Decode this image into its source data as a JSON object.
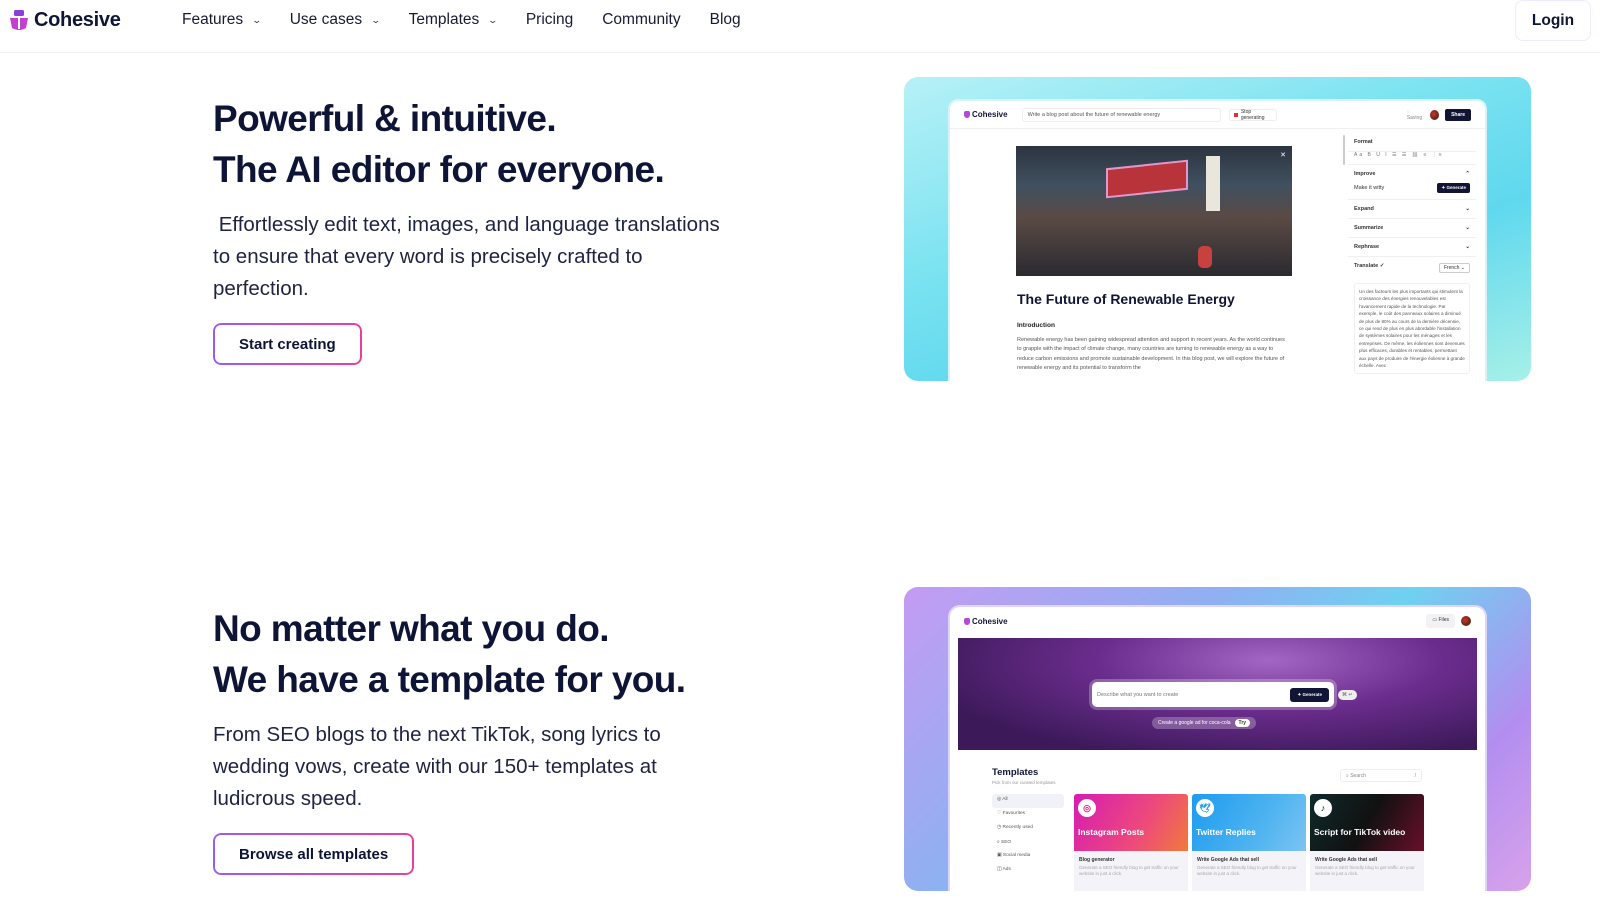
{
  "nav": {
    "brand": "Cohesive",
    "items": [
      {
        "label": "Features",
        "dropdown": true
      },
      {
        "label": "Use cases",
        "dropdown": true
      },
      {
        "label": "Templates",
        "dropdown": true
      },
      {
        "label": "Pricing",
        "dropdown": false
      },
      {
        "label": "Community",
        "dropdown": false
      },
      {
        "label": "Blog",
        "dropdown": false
      }
    ],
    "login_label": "Login",
    "brand_color": "#b349d6"
  },
  "section1": {
    "title_line1": "Powerful & intuitive.",
    "title_line2": "The AI editor for everyone.",
    "description": " Effortlessly edit text, images, and language translations to ensure that every word is precisely crafted to perfection.",
    "cta_label": "Start creating",
    "preview": {
      "brand": "Cohesive",
      "prompt": "Write a blog post about the future of renewable energy",
      "stop_label": "Stop generating",
      "saving_label": "Saving",
      "share_label": "Share",
      "doc_title": "The Future of Renewable Energy",
      "doc_heading": "Introduction",
      "doc_body": "Renewable energy has been gaining widespread attention and support in recent years. As the world continues to grapple with the impact of climate change, many countries are turning to renewable energy as a way to reduce carbon emissions and promote sustainable development. In this blog post, we will explore the future of renewable energy and its potential to transform the",
      "panel": {
        "format_label": "Format",
        "format_tools": "Aa B U I ☰ ☰ ⛓ ≡ ⋮≡",
        "improve_label": "Improve",
        "improve_value": "Make it witty",
        "generate_label": "Generate",
        "expand_label": "Expand",
        "summarize_label": "Summarize",
        "rephrase_label": "Rephrase",
        "translate_label": "Translate",
        "language": "French",
        "translated_text": "Un des facteurs les plus importants qui stimulent la croissance des énergies renouvelables est l'avancement rapide de la technologie. Par exemple, le coût des panneaux solaires a diminué de plus de 80% au cours de la dernière décennie, ce qui rend de plus en plus abordable l'installation de systèmes solaires pour les ménages et les entreprises. De même, les éoliennes sont devenues plus efficaces, durables et rentables, permettant aux pays de produire de l'énergie éolienne à grande échelle. Avec"
      }
    }
  },
  "section2": {
    "title_line1": "No matter what you do.",
    "title_line2": "We have a template for you.",
    "description": "From SEO blogs to the next TikTok, song lyrics to wedding vows, create with our 150+ templates at ludicrous speed.",
    "cta_label": "Browse all templates",
    "preview": {
      "brand": "Cohesive",
      "files_label": "Files",
      "input_placeholder": "Describe what you want to create",
      "generate_label": "Generate",
      "shortcut": "⌘ ↵",
      "suggestion": "Create a google ad for coca-cola",
      "try_label": "Try",
      "templates_title": "Templates",
      "templates_subtitle": "Pick from our curated templates",
      "search_placeholder": "Search",
      "search_shortcut": "/",
      "categories": [
        "All",
        "Favourites",
        "Recently used",
        "SEO",
        "Social media",
        "Ads"
      ],
      "cards": [
        {
          "title": "Instagram Posts",
          "name": "Blog generator",
          "desc": "Generate a SEO friendly blog to get traffic on your website in just a click.",
          "icon": "instagram-icon"
        },
        {
          "title": "Twitter Replies",
          "name": "Write Google Ads that sell",
          "desc": "Generate a SEO friendly blog to get traffic on your website in just a click.",
          "icon": "twitter-icon"
        },
        {
          "title": "Script for TikTok video",
          "name": "Write Google Ads that sell",
          "desc": "Generate a SEO friendly blog to get traffic on your website in just a click.",
          "icon": "tiktok-icon"
        }
      ]
    }
  }
}
